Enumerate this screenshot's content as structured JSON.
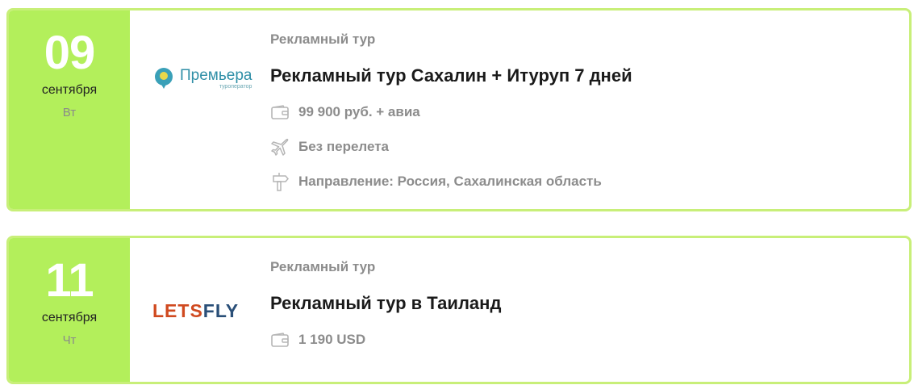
{
  "tours": [
    {
      "day": "09",
      "month": "сентября",
      "weekday": "Вт",
      "logo_text": "Премьера",
      "logo_sub": "туроператор",
      "type": "Рекламный тур",
      "title": "Рекламный тур Сахалин + Итуруп 7 дней",
      "price": "99 900 руб. + авиа",
      "flight": "Без перелета",
      "direction": "Направление: Россия, Сахалинская область"
    },
    {
      "day": "11",
      "month": "сентября",
      "weekday": "Чт",
      "logo_text_a": "LETS",
      "logo_text_b": "FLY",
      "type": "Рекламный тур",
      "title": "Рекламный тур в Таиланд",
      "price": "1 190 USD"
    }
  ],
  "colors": {
    "accent": "#b3ef5b",
    "border": "#c8ef79"
  }
}
